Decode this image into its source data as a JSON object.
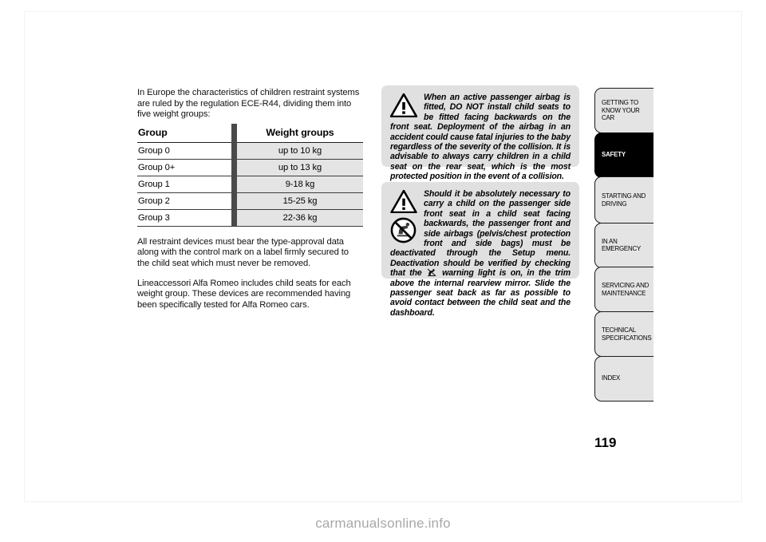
{
  "page": {
    "number": "119",
    "watermark": "carmanualsonline.info"
  },
  "left_column": {
    "intro": "In Europe the characteristics of children restraint systems are ruled by the regulation ECE-R44, dividing them into five weight groups:",
    "table": {
      "headers": [
        "Group",
        "Weight groups"
      ],
      "rows": [
        [
          "Group 0",
          "up to 10 kg"
        ],
        [
          "Group 0+",
          "up to 13 kg"
        ],
        [
          "Group 1",
          "9-18 kg"
        ],
        [
          "Group 2",
          "15-25 kg"
        ],
        [
          "Group 3",
          "22-36 kg"
        ]
      ]
    },
    "para2": "All restraint devices must bear the type-approval data along with the control mark on a label firmly secured to the child seat which must never be removed.",
    "para3": "Lineaccessori Alfa Romeo includes child seats for each weight group. These devices are recommended having been specifically tested for Alfa Romeo cars."
  },
  "warnings": [
    {
      "id": "airbag-rear-facing-warning",
      "icons": [
        "warning-triangle-icon"
      ],
      "text": "When an active passenger airbag is fitted, DO NOT install child seats to be fitted facing backwards on the front seat. Deployment of the airbag in an accident could cause fatal injuries to the baby regardless of the severity of the collision. It is advisable to always carry children in a child seat on the rear seat, which is the most protected position in the event of a collision."
    },
    {
      "id": "airbag-deactivation-warning",
      "icons": [
        "warning-triangle-icon",
        "no-rear-facing-child-seat-icon"
      ],
      "text_part1": "Should it be absolutely necessary to carry a child on the passenger side front seat in a child seat facing backwards, the passenger front and side airbags (pelvis/chest protection front and side bags) must be deactivated through the Setup menu. Deactivation should be verified by checking that the ",
      "inline_icon": "airbag-off-warning-light-icon",
      "text_part2": " warning light is on, in the trim above the internal rearview mirror. Slide the passenger seat back as far as possible to avoid contact between the child seat and the dashboard."
    }
  ],
  "tabs": [
    {
      "id": "getting-to-know-your-car",
      "label": "GETTING TO KNOW YOUR CAR",
      "active": false
    },
    {
      "id": "safety",
      "label": "SAFETY",
      "active": true
    },
    {
      "id": "starting-and-driving",
      "label": "STARTING AND DRIVING",
      "active": false
    },
    {
      "id": "in-an-emergency",
      "label": "IN AN EMERGENCY",
      "active": false
    },
    {
      "id": "servicing-and-maintenance",
      "label": "SERVICING AND MAINTENANCE",
      "active": false
    },
    {
      "id": "technical-specifications",
      "label": "TECHNICAL SPECIFICATIONS",
      "active": false
    },
    {
      "id": "index",
      "label": "INDEX",
      "active": false
    }
  ],
  "colors": {
    "tab_inactive_bg": "#e4e4e4",
    "tab_active_bg": "#000000",
    "warning_box_bg": "#e0e0e0",
    "table_cell_bg": "#e4e4e4",
    "watermark": "#a8a8a8"
  }
}
